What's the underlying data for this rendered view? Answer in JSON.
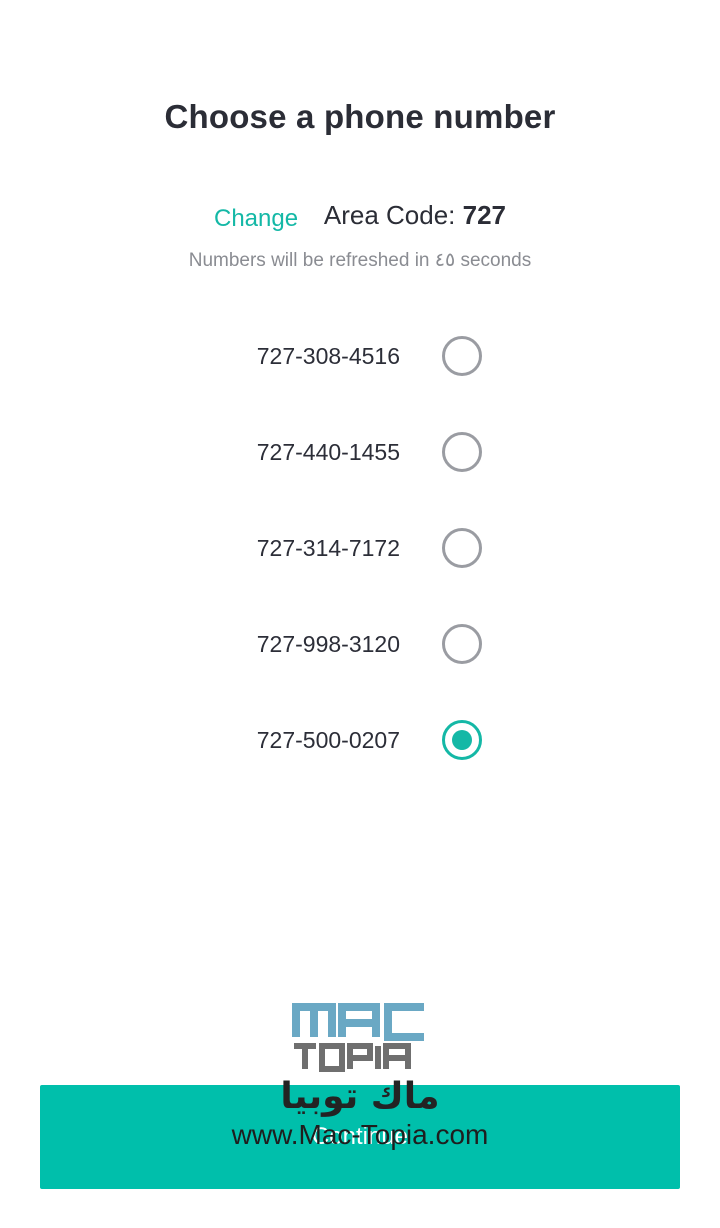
{
  "header": {
    "title": "Choose a phone number"
  },
  "area": {
    "change_label": "Change",
    "label": "Area Code:",
    "value": "727",
    "refresh_note": "Numbers will be refreshed in ٤٥ seconds"
  },
  "numbers": [
    {
      "number": "727-308-4516",
      "selected": false
    },
    {
      "number": "727-440-1455",
      "selected": false
    },
    {
      "number": "727-314-7172",
      "selected": false
    },
    {
      "number": "727-998-3120",
      "selected": false
    },
    {
      "number": "727-500-0207",
      "selected": true
    }
  ],
  "footer": {
    "continue_label": "Continue"
  },
  "watermark": {
    "logo_text": "MAC TOPIA",
    "arabic_text": "ماك توبيا",
    "url": "www.Mac-Topia.com"
  },
  "colors": {
    "accent": "#14b8a6",
    "button": "#00bfab",
    "title": "#2b2d36",
    "muted": "#8a8c92",
    "radio_unchecked": "#9a9ca2"
  }
}
